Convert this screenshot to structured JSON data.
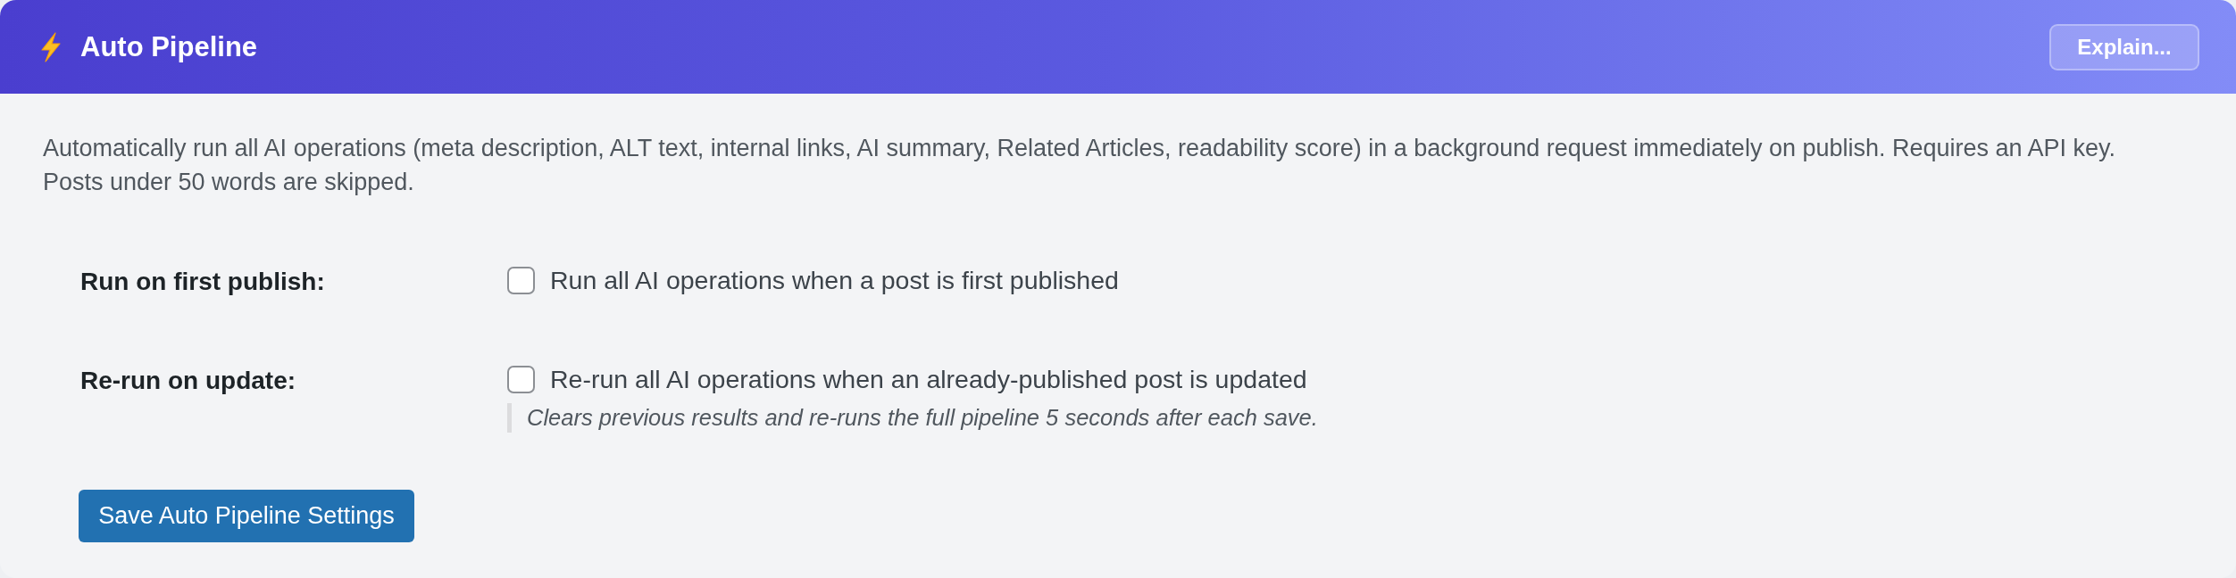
{
  "header": {
    "title": "Auto Pipeline",
    "button": "Explain..."
  },
  "description": "Automatically run all AI operations (meta description, ALT text, internal links, AI summary, Related Articles, readability score) in a background request immediately on publish. Requires an API key. Posts under 50 words are skipped.",
  "settings": [
    {
      "label": "Run on first publish:",
      "option": "Run all AI operations when a post is first published",
      "checked": false
    },
    {
      "label": "Re-run on update:",
      "option": "Re-run all AI operations when an already-published post is updated",
      "checked": false,
      "hint": "Clears previous results and re-runs the full pipeline 5 seconds after each save."
    }
  ],
  "save_button": "Save Auto Pipeline Settings"
}
